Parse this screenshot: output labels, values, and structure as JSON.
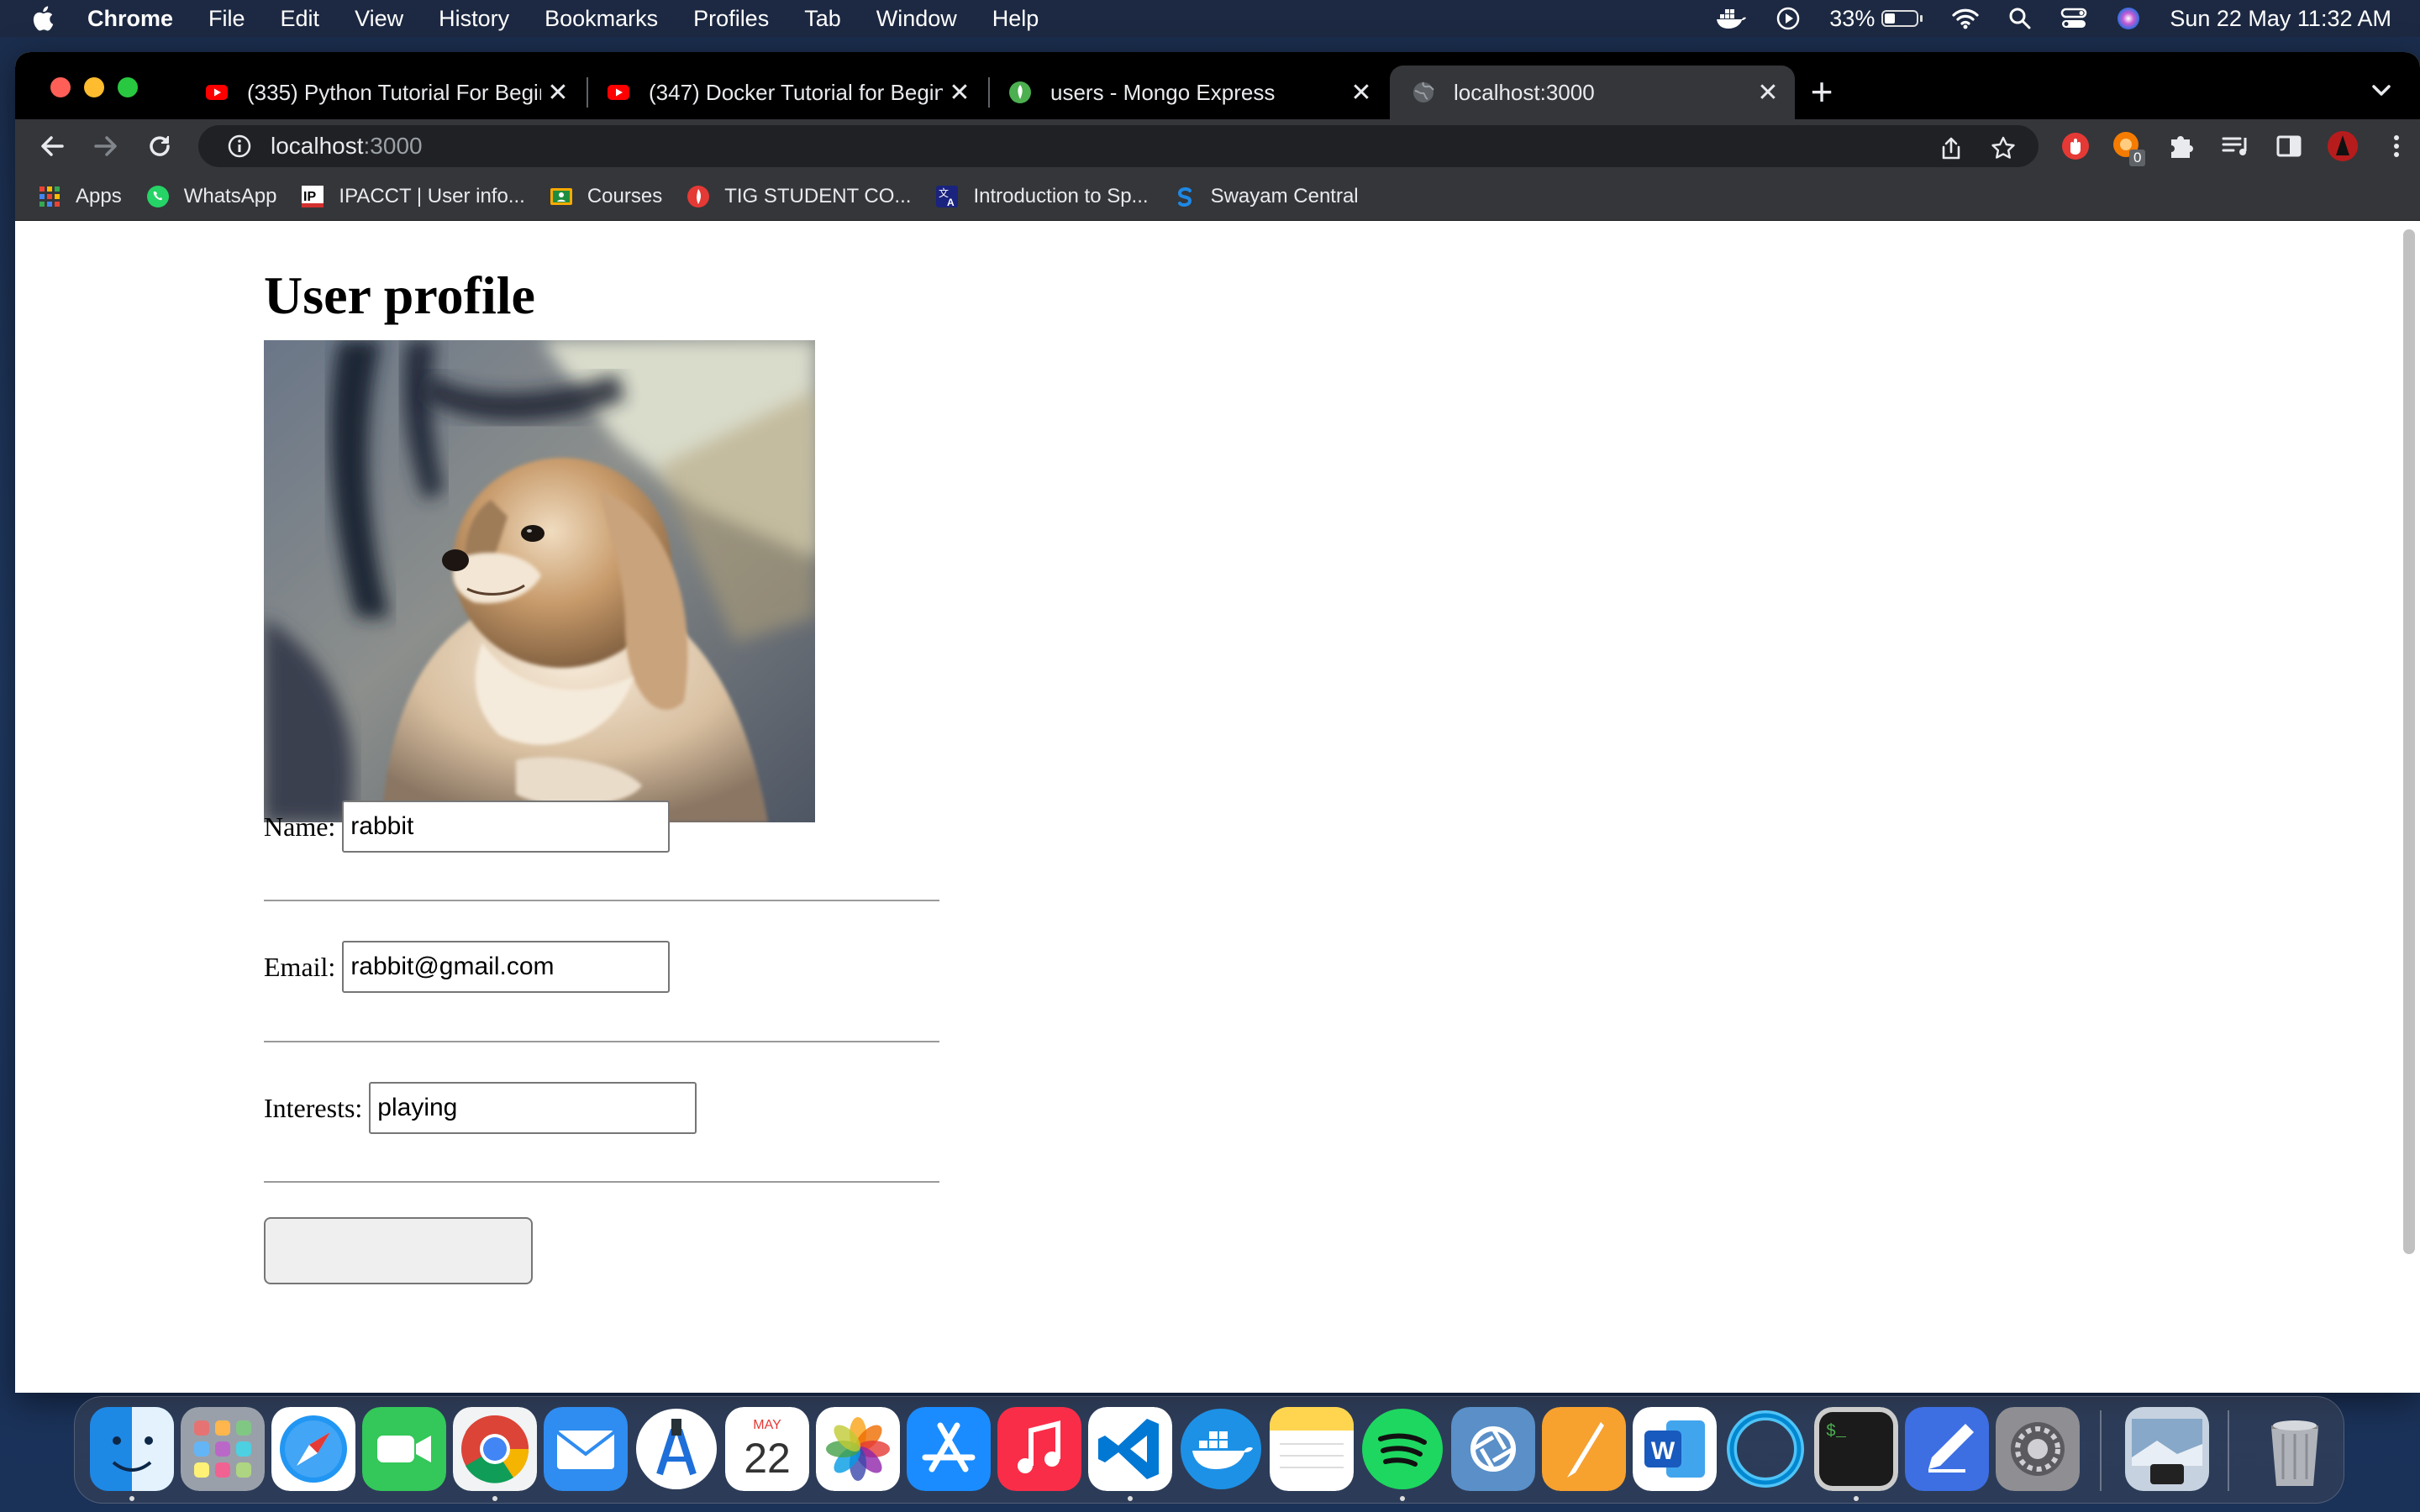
{
  "menubar": {
    "app_name": "Chrome",
    "items": [
      "File",
      "Edit",
      "View",
      "History",
      "Bookmarks",
      "Profiles",
      "Tab",
      "Window",
      "Help"
    ],
    "battery_percent": "33%",
    "battery_level": 0.33,
    "clock": "Sun 22 May  11:32 AM"
  },
  "tabs": [
    {
      "title": "(335) Python Tutorial For Beginners",
      "favicon": "youtube-icon"
    },
    {
      "title": "(347) Docker Tutorial for Beginners",
      "favicon": "youtube-icon"
    },
    {
      "title": "users - Mongo Express",
      "favicon": "mongo-leaf-icon"
    },
    {
      "title": "localhost:3000",
      "favicon": "globe-icon",
      "active": true
    }
  ],
  "omnibox": {
    "host": "localhost",
    "port": ":3000"
  },
  "bookmarks": [
    {
      "label": "Apps",
      "icon": "apps-grid-icon"
    },
    {
      "label": "WhatsApp",
      "icon": "whatsapp-icon"
    },
    {
      "label": "IPACCT | User info...",
      "icon": "ipacct-icon"
    },
    {
      "label": "Courses",
      "icon": "classroom-icon"
    },
    {
      "label": "TIG STUDENT CO...",
      "icon": "tig-icon"
    },
    {
      "label": "Introduction to Sp...",
      "icon": "translate-icon"
    },
    {
      "label": "Swayam Central",
      "icon": "swayam-icon"
    }
  ],
  "page": {
    "heading": "User profile",
    "photo_alt": "dog photo",
    "name_label": "Name:",
    "name_value": "rabbit",
    "email_label": "Email:",
    "email_value": "rabbit@gmail.com",
    "interests_label": "Interests:",
    "interests_value": "playing"
  },
  "dock": {
    "apps": [
      "finder-icon",
      "launchpad-icon",
      "safari-icon",
      "facetime-icon",
      "chrome-icon",
      "mail-icon",
      "xcode-instruments-icon",
      "calendar-icon",
      "photos-icon",
      "app-store-icon",
      "music-icon",
      "vscode-icon",
      "docker-icon",
      "notes-icon",
      "spotify-icon",
      "screenshot-icon",
      "pages-icon",
      "word-icon",
      "cortana-ring-icon",
      "terminal-icon",
      "sketch-pencil-icon",
      "system-preferences-icon",
      "preview-icon",
      "trash-icon"
    ],
    "calendar_month": "MAY",
    "calendar_day": "22",
    "terminal_prompt": "$_",
    "word_letter": "W"
  },
  "ext_badge": "0"
}
